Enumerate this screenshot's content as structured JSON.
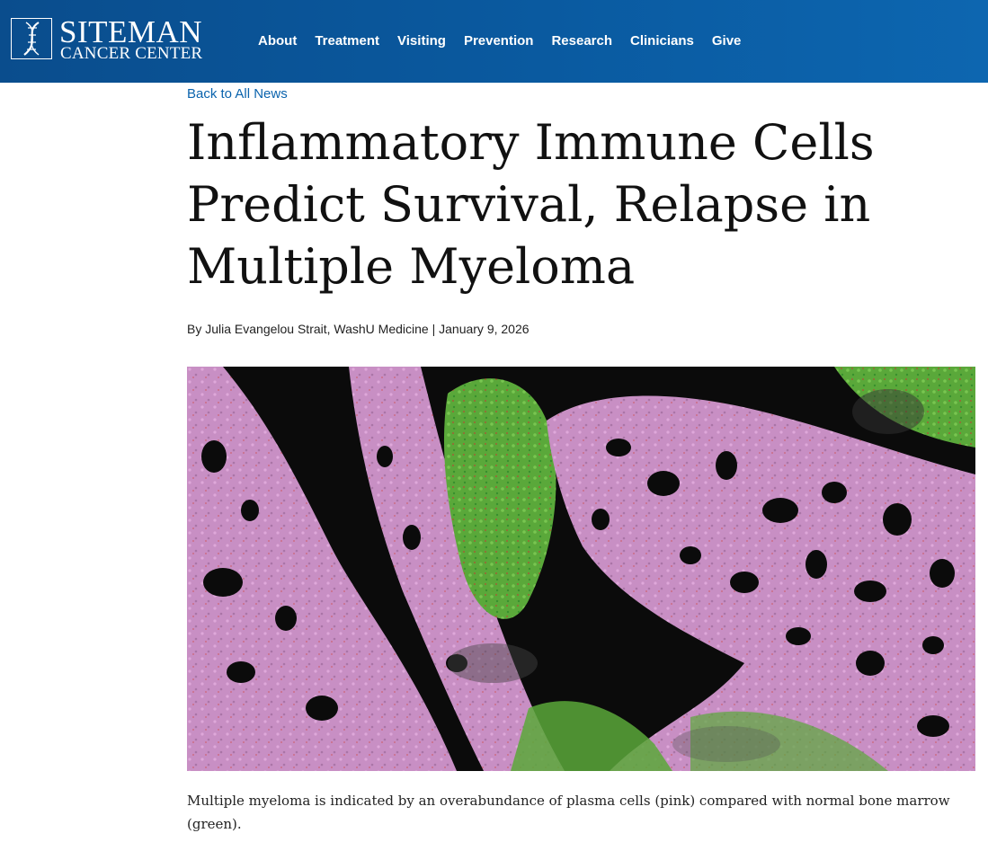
{
  "logo": {
    "line1": "SITEMAN",
    "line2": "CANCER CENTER",
    "icon": "dna-helix-icon"
  },
  "nav": [
    "About",
    "Treatment",
    "Visiting",
    "Prevention",
    "Research",
    "Clinicians",
    "Give"
  ],
  "back_link": "Back to All News",
  "article": {
    "title": "Inflammatory Immune Cells Predict Survival, Relapse in Multiple Myeloma",
    "byline": "By Julia Evangelou Strait, WashU Medicine | January 9, 2026",
    "caption": "Multiple myeloma is indicated by an overabundance of plasma cells (pink) compared with normal bone marrow (green)."
  },
  "colors": {
    "header_blue": "#0a5aa0",
    "link_blue": "#0a63ad",
    "plasma_pink": "#c88fc4",
    "marrow_green": "#5aa83a"
  }
}
